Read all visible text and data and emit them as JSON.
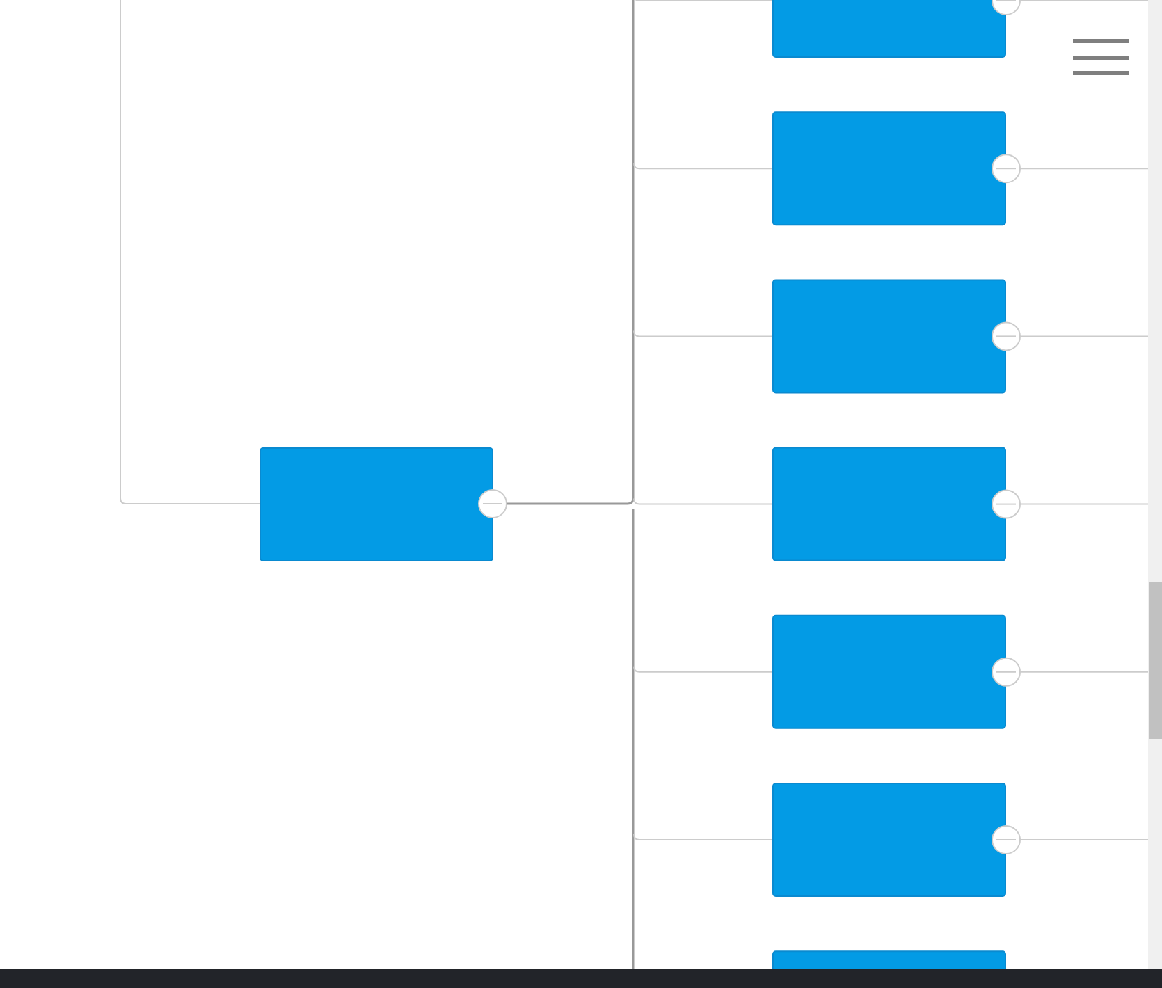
{
  "diagram": {
    "root": {
      "expanded": true,
      "children": [
        {
          "kind": "node",
          "expanded": true
        },
        {
          "kind": "node",
          "expanded": true
        },
        {
          "kind": "node",
          "expanded": true
        },
        {
          "kind": "node",
          "expanded": true
        },
        {
          "kind": "node",
          "expanded": true
        },
        {
          "kind": "node",
          "expanded": true
        },
        {
          "kind": "node"
        }
      ]
    }
  }
}
